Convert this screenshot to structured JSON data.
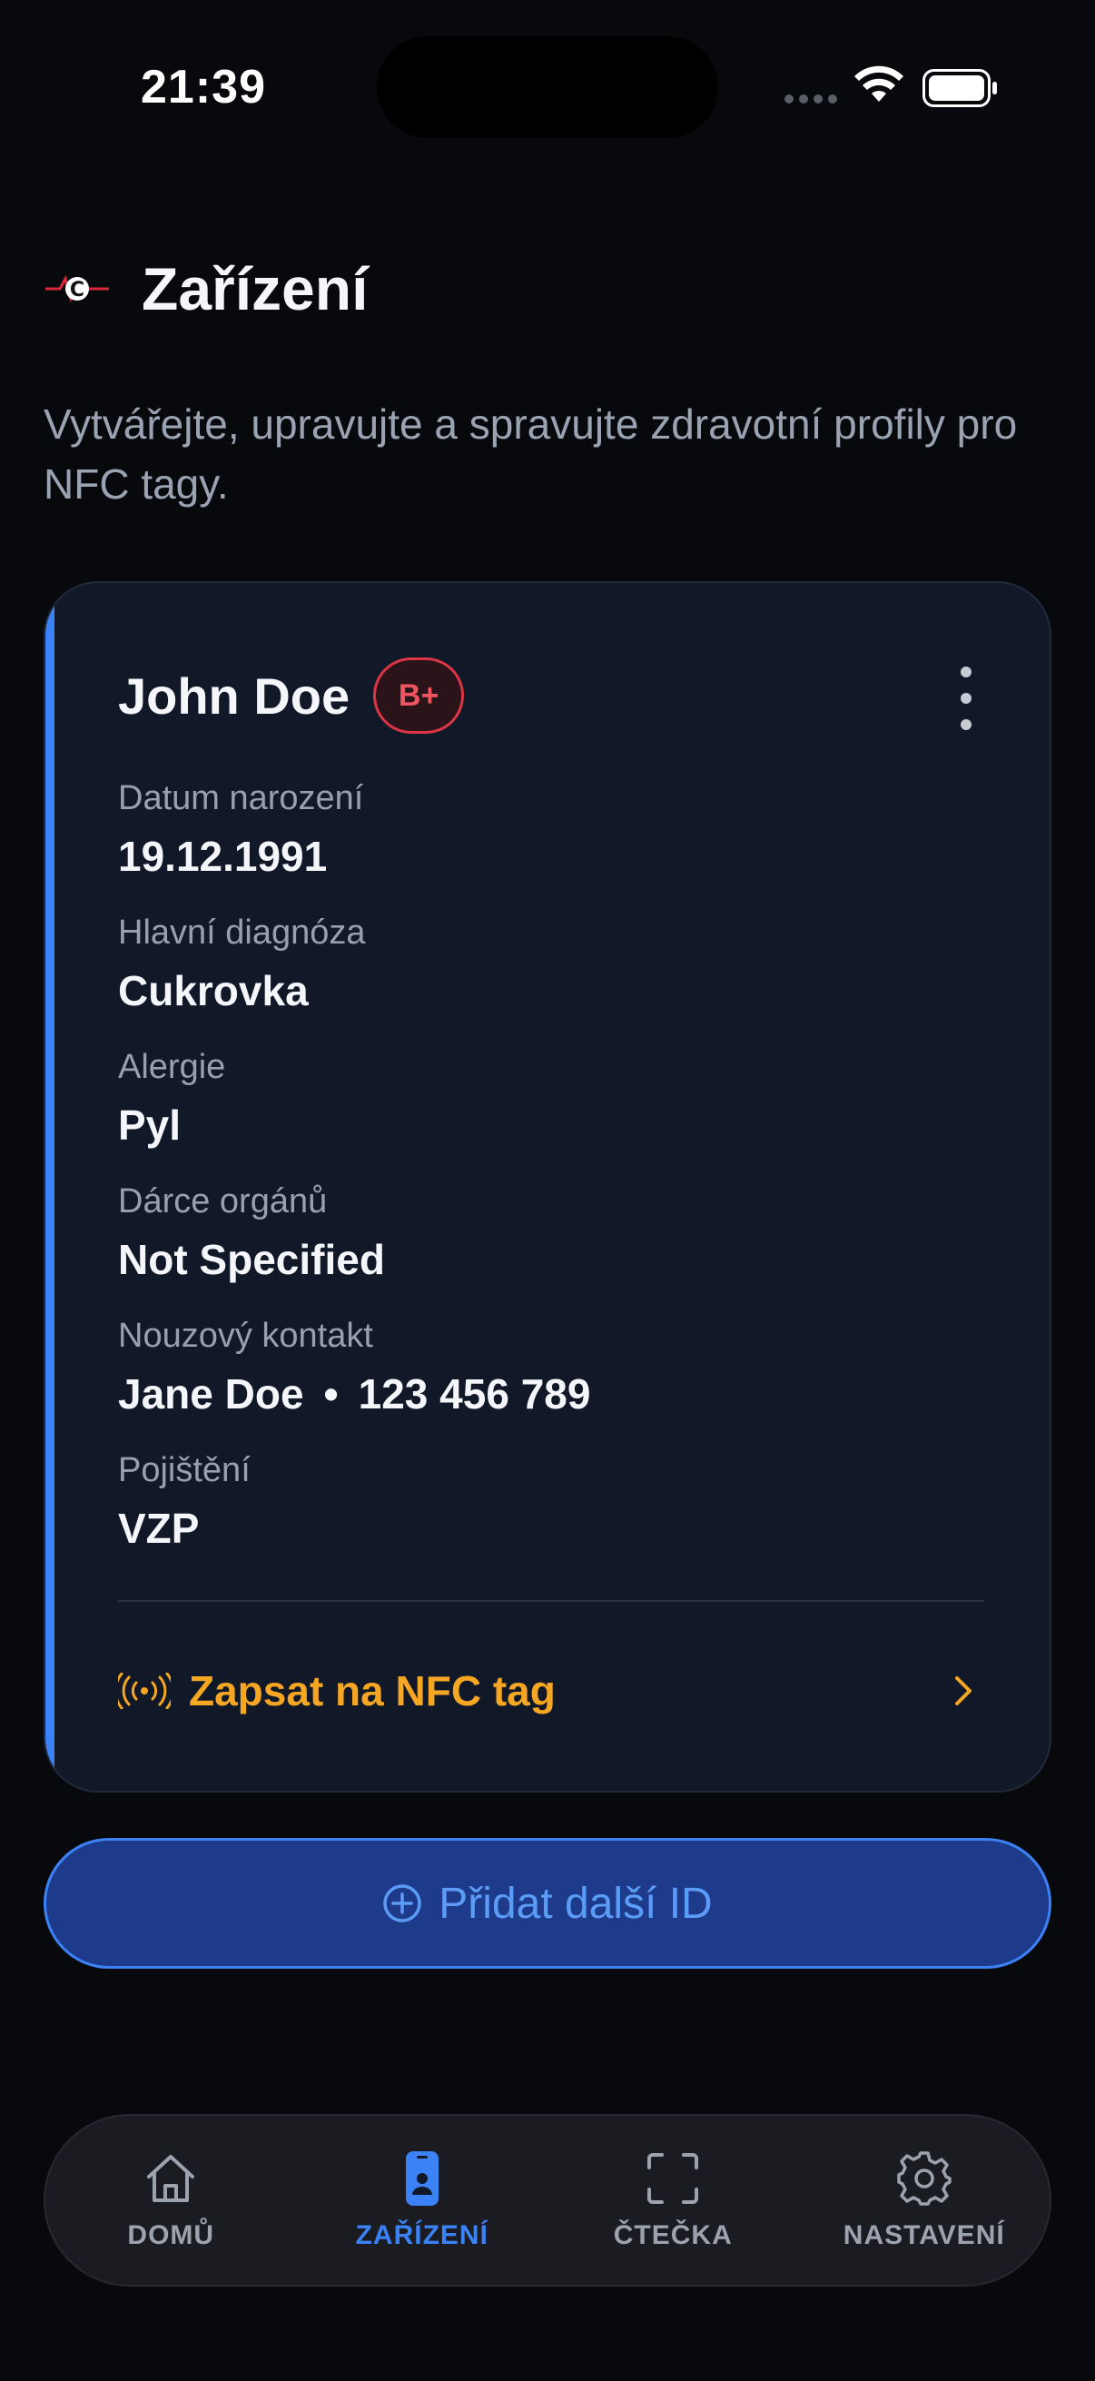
{
  "status_bar": {
    "time": "21:39"
  },
  "header": {
    "title": "Zařízení",
    "subtitle": "Vytvářejte, upravujte a spravujte zdravotní profily pro NFC tagy."
  },
  "card": {
    "name": "John Doe",
    "blood_type": "B+",
    "fields": [
      {
        "label": "Datum narození",
        "value": "19.12.1991"
      },
      {
        "label": "Hlavní diagnóza",
        "value": "Cukrovka"
      },
      {
        "label": "Alergie",
        "value": "Pyl"
      },
      {
        "label": "Dárce orgánů",
        "value": "Not Specified"
      },
      {
        "label": "Nouzový kontakt",
        "contact_name": "Jane Doe",
        "contact_phone": "123 456 789"
      },
      {
        "label": "Pojištění",
        "value": "VZP"
      }
    ],
    "nfc_action": "Zapsat na NFC tag"
  },
  "add_button": {
    "label": "Přidat další ID"
  },
  "nav": {
    "items": [
      {
        "label": "DOMŮ",
        "icon": "home-icon",
        "active": false
      },
      {
        "label": "ZAŘÍZENÍ",
        "icon": "phone-id-icon",
        "active": true
      },
      {
        "label": "ČTEČKA",
        "icon": "scan-icon",
        "active": false
      },
      {
        "label": "NASTAVENÍ",
        "icon": "gear-icon",
        "active": false
      }
    ]
  },
  "colors": {
    "background": "#08090d",
    "card": "#111827",
    "accent_blue": "#3b82f6",
    "accent_orange": "#f5a623",
    "badge_red": "#dc3545"
  }
}
